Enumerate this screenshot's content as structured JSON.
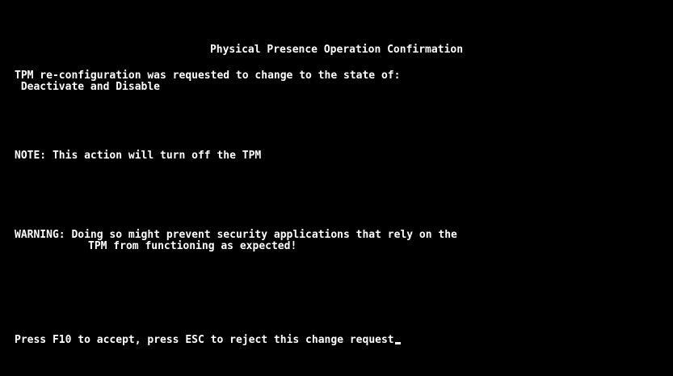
{
  "screen": {
    "title": "Physical Presence Operation Confirmation",
    "request_text": "TPM re-configuration was requested to change to the state of:",
    "requested_state": " Deactivate and Disable",
    "note_text": "NOTE: This action will turn off the TPM",
    "warning_label": "WARNING: ",
    "warning_text_line1": "Doing so might prevent security applications that rely on the",
    "warning_text_line2": "TPM from functioning as expected!",
    "prompt": {
      "prefix": "Press ",
      "accept_key": "F10",
      "middle": " to accept, press ",
      "reject_key": "ESC",
      "suffix": " to reject this change request"
    }
  },
  "colors": {
    "background": "#000000",
    "text": "#ffffff"
  },
  "icons": {
    "cursor": "text-cursor-icon"
  }
}
